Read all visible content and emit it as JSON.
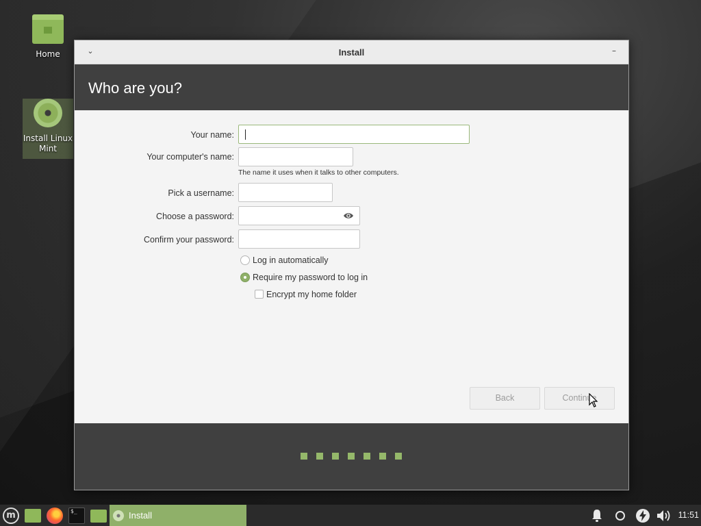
{
  "desktop": {
    "icons": [
      {
        "label": "Home",
        "icon": "home-folder-icon"
      },
      {
        "label": "Install Linux Mint",
        "icon": "disc-icon"
      }
    ]
  },
  "window": {
    "title": "Install",
    "heading": "Who are you?",
    "fields": {
      "your_name": {
        "label": "Your name:",
        "value": ""
      },
      "computer_name": {
        "label": "Your computer's name:",
        "value": "",
        "hint": "The name it uses when it talks to other computers."
      },
      "username": {
        "label": "Pick a username:",
        "value": ""
      },
      "password": {
        "label": "Choose a password:",
        "value": ""
      },
      "confirm_password": {
        "label": "Confirm your password:",
        "value": ""
      }
    },
    "options": {
      "login_auto": {
        "label": "Log in automatically",
        "checked": false
      },
      "require_password": {
        "label": "Require my password to log in",
        "checked": true
      },
      "encrypt_home": {
        "label": "Encrypt my home folder",
        "checked": false
      }
    },
    "buttons": {
      "back": "Back",
      "continue": "Continue"
    },
    "progress": {
      "steps_total": 7,
      "accent": "#95b86a"
    }
  },
  "taskbar": {
    "launchers": [
      "menu-icon",
      "files-icon",
      "firefox-icon",
      "terminal-icon",
      "folder-icon"
    ],
    "active_task": "Install",
    "tray": [
      "bell-icon",
      "network-icon",
      "power-icon",
      "volume-icon"
    ],
    "clock": "11:51",
    "accent": "#8fb069"
  }
}
